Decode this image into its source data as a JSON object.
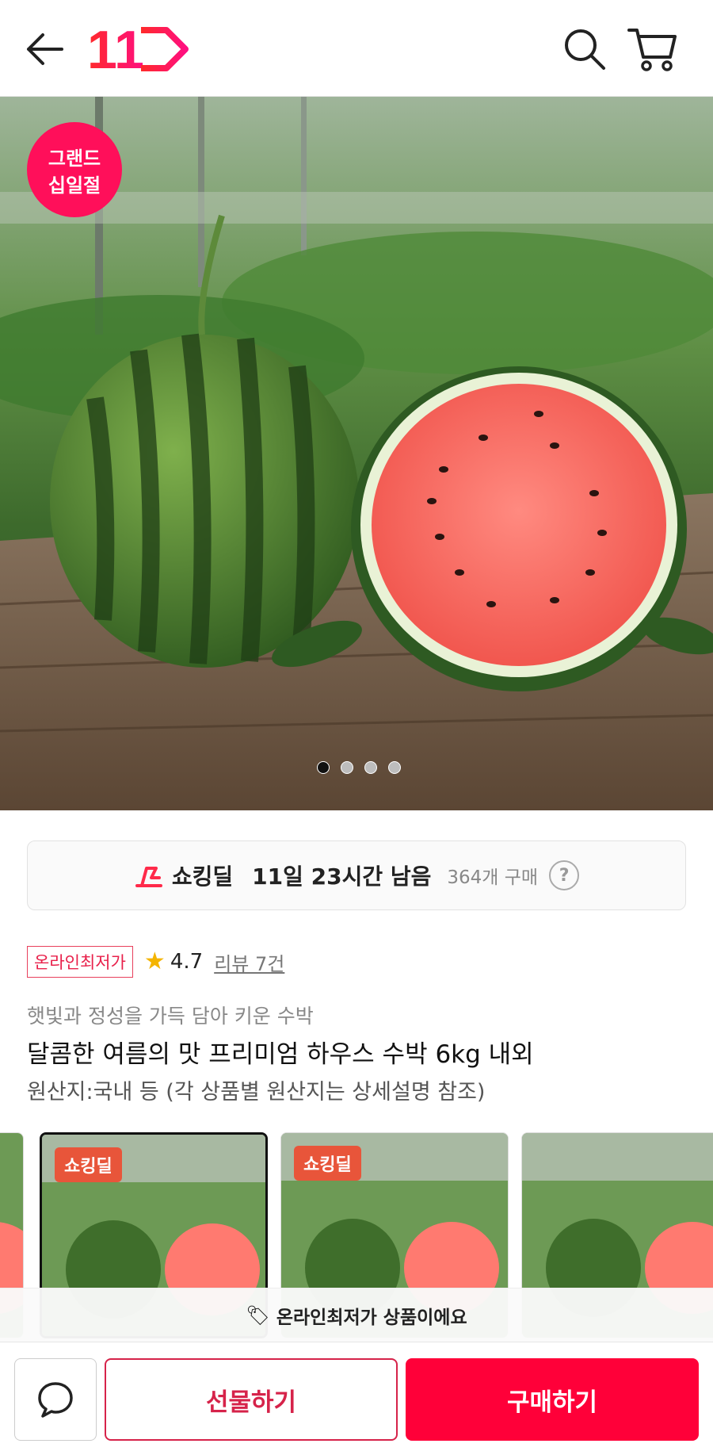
{
  "header": {
    "back_icon": "arrow-left-icon",
    "logo_text": "11",
    "search_icon": "search-icon",
    "cart_icon": "cart-icon"
  },
  "hero": {
    "badge_line1": "그랜드",
    "badge_line2": "십일절",
    "slide_count": 4,
    "active_slide": 1
  },
  "deal": {
    "label": "쇼킹딜",
    "time_left": "11일 23시간 남음",
    "purchase_count": "364개 구매",
    "help_label": "?"
  },
  "product": {
    "tag": "온라인최저가",
    "rating": "4.7",
    "review_link": "리뷰 7건",
    "subtitle": "햇빛과 정성을 가득 담아 키운 수박",
    "title": "달콤한 여름의 맛 프리미엄 하우스 수박 6kg 내외",
    "origin": "원산지:국내 등 (각 상품별 원산지는 상세설명 참조)"
  },
  "options": {
    "items": [
      {
        "badge": ""
      },
      {
        "badge": "쇼킹딜"
      },
      {
        "badge": "쇼킹딜"
      },
      {
        "badge": ""
      }
    ]
  },
  "notice": {
    "icon": "tag-icon",
    "text": "온라인최저가 상품이에요"
  },
  "bottom_bar": {
    "chat_icon": "chat-bubble-icon",
    "gift_label": "선물하기",
    "buy_label": "구매하기"
  },
  "colors": {
    "brand_red": "#ff0039",
    "gift_border": "#d6234a",
    "deal_badge": "#e8553a"
  }
}
